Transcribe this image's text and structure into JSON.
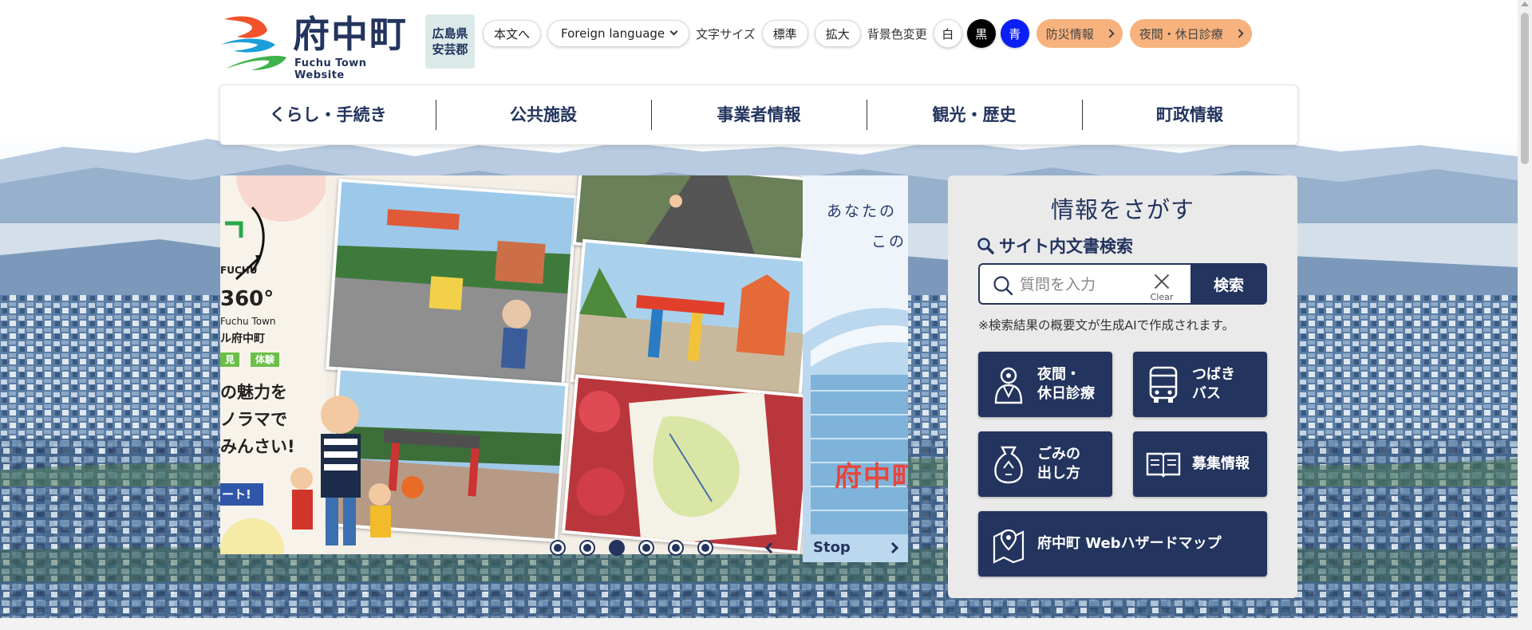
{
  "header": {
    "logo_title": "府中町",
    "logo_sub": "Fuchu Town Website",
    "pref_line1": "広島県",
    "pref_line2": "安芸郡",
    "skip_label": "本文へ",
    "lang_label": "Foreign language",
    "font_size_label": "文字サイズ",
    "font_normal": "標準",
    "font_large": "拡大",
    "bg_color_label": "背景色変更",
    "bg_white": "白",
    "bg_black": "黒",
    "bg_blue": "青",
    "disaster_label": "防災情報",
    "night_clinic_label": "夜間・休日診療"
  },
  "nav": {
    "items": [
      "くらし・手続き",
      "公共施設",
      "事業者情報",
      "観光・歴史",
      "町政情報"
    ]
  },
  "slider": {
    "left_badge": "FUCHU",
    "left_360": "360°",
    "left_town": "Fuchu Town",
    "left_virtual": "ル府中町",
    "tag1": "見",
    "tag2": "体験",
    "copy1": "の魅力を",
    "copy2": "ノラマで",
    "copy3": "みんさい!",
    "start": "ート!",
    "next_line1": "あなたの",
    "next_line2": "この",
    "next_red": "府中町",
    "stop_label": "Stop",
    "dots": 6,
    "active_dot": 3
  },
  "search": {
    "title": "情報をさがす",
    "subtitle": "サイト内文書検索",
    "placeholder": "質問を入力",
    "clear_label": "Clear",
    "button_label": "検索",
    "note": "※検索結果の概要文が生成AIで作成されます。"
  },
  "quick_links": {
    "night": "夜間・\n休日診療",
    "bus": "つばき\nバス",
    "garbage": "ごみの\n出し方",
    "recruit": "募集情報",
    "hazard": "府中町 Webハザードマップ"
  },
  "colors": {
    "navy": "#23345e",
    "orange": "#f7b27d",
    "panel_bg": "#eaeaea",
    "blue_dot": "#0a1ef5"
  }
}
